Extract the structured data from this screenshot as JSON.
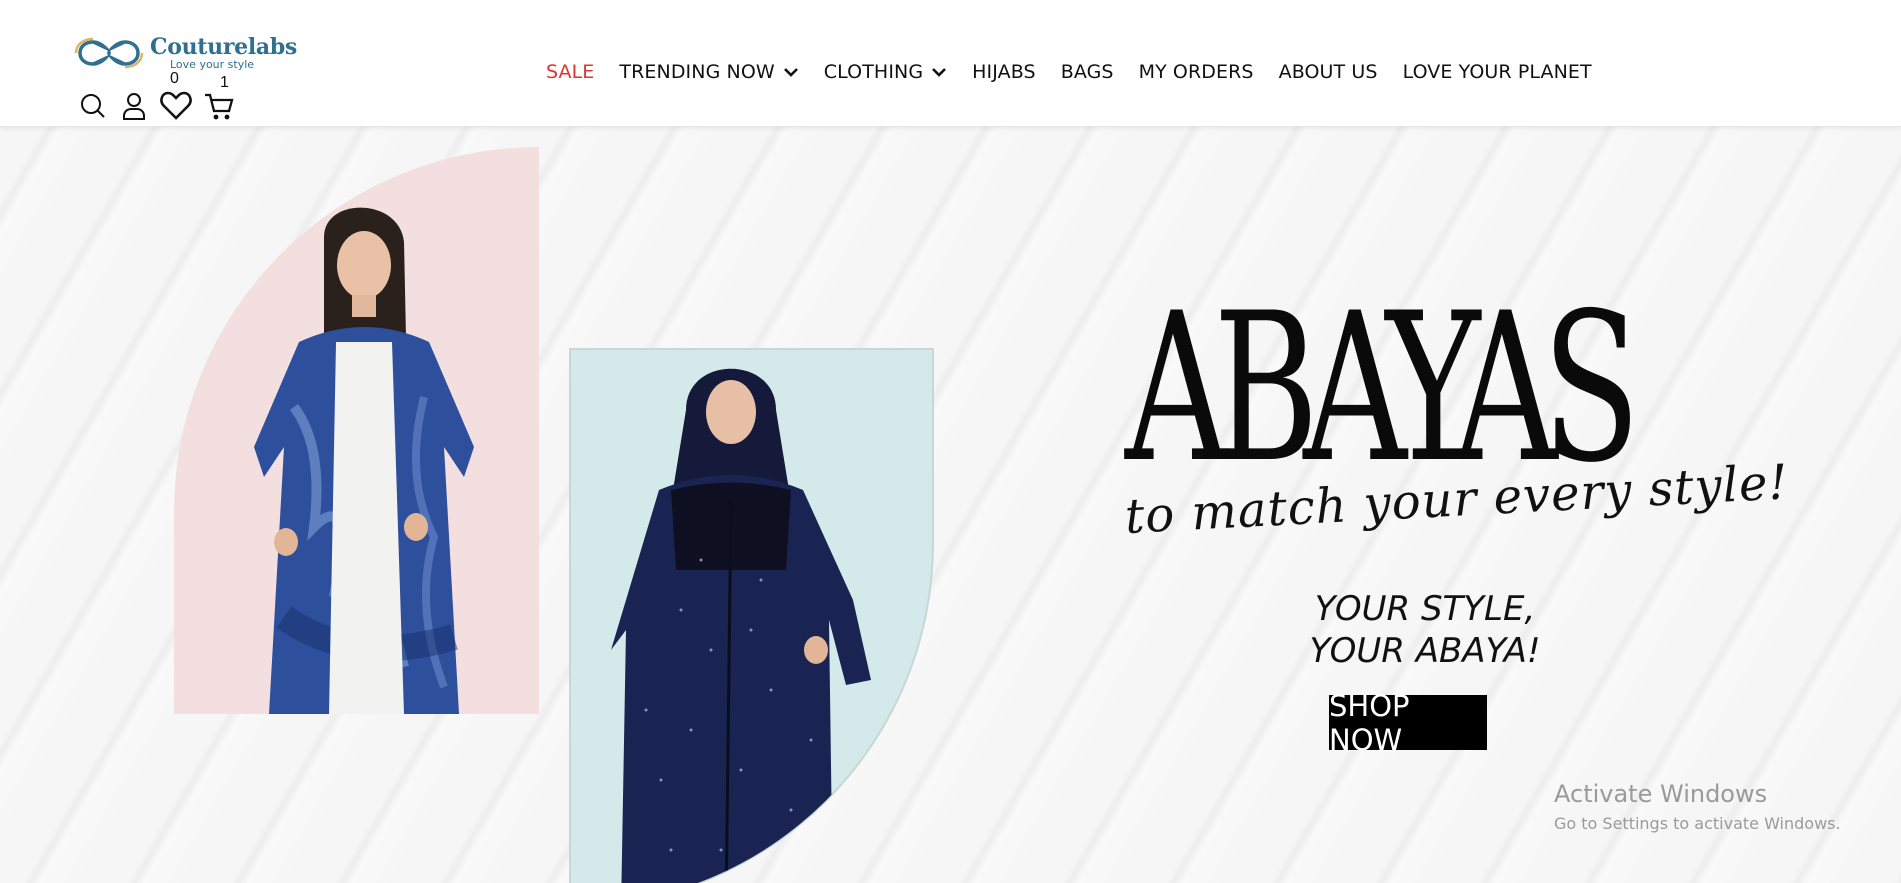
{
  "header": {
    "logo": {
      "name": "Couturelabs",
      "tagline": "Love your style"
    },
    "icons": {
      "wishlist_count": "0",
      "cart_count": "1"
    },
    "nav": [
      {
        "label": "SALE",
        "dropdown": false
      },
      {
        "label": "TRENDING NOW",
        "dropdown": true
      },
      {
        "label": "CLOTHING",
        "dropdown": true
      },
      {
        "label": "HIJABS",
        "dropdown": false
      },
      {
        "label": "BAGS",
        "dropdown": false
      },
      {
        "label": "MY ORDERS",
        "dropdown": false
      },
      {
        "label": "ABOUT US",
        "dropdown": false
      },
      {
        "label": "LOVE YOUR PLANET",
        "dropdown": false
      }
    ]
  },
  "hero": {
    "headline": "ABAYAS",
    "script": "to match your every style!",
    "tagline_line1": "YOUR STYLE,",
    "tagline_line2": "YOUR ABAYA!",
    "cta": "SHOP NOW"
  },
  "watermark": {
    "title": "Activate Windows",
    "subtitle": "Go to Settings to activate Windows."
  },
  "colors": {
    "sale": "#e0332f",
    "brand": "#2f6f8f",
    "pink_panel": "#f3dfe0",
    "blue_panel": "#d3e9ea",
    "cta_bg": "#000000"
  }
}
